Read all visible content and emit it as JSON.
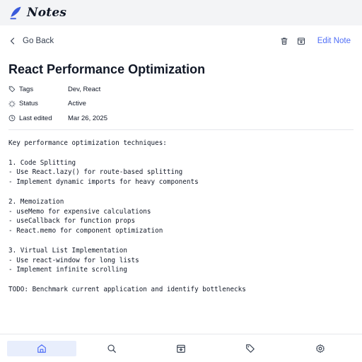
{
  "app": {
    "name": "Notes"
  },
  "toolbar": {
    "back_label": "Go Back",
    "edit_label": "Edit Note",
    "icons": [
      "trash-icon",
      "archive-icon"
    ]
  },
  "note": {
    "title": "React Performance Optimization",
    "meta": {
      "tags_label": "Tags",
      "tags_value": "Dev, React",
      "status_label": "Status",
      "status_value": "Active",
      "edited_label": "Last edited",
      "edited_value": "Mar 26, 2025"
    },
    "body_lines": [
      "Key performance optimization techniques:",
      "",
      "1. Code Splitting",
      "- Use React.lazy() for route-based splitting",
      "- Implement dynamic imports for heavy components",
      "",
      "2. Memoization",
      "- useMemo for expensive calculations",
      "- useCallback for function props",
      "- React.memo for component optimization",
      "",
      "3. Virtual List Implementation",
      "- Use react-window for long lists",
      "- Implement infinite scrolling",
      "",
      "TODO: Benchmark current application and identify bottlenecks"
    ]
  },
  "bottom_nav": {
    "items": [
      {
        "icon": "home-icon",
        "active": true
      },
      {
        "icon": "search-icon",
        "active": false
      },
      {
        "icon": "archive-icon",
        "active": false
      },
      {
        "icon": "tag-icon",
        "active": false
      },
      {
        "icon": "settings-icon",
        "active": false
      }
    ]
  },
  "colors": {
    "accent": "#4f6ef7",
    "header_bg": "#f3f4f6",
    "active_nav_bg": "#e8eefc"
  }
}
